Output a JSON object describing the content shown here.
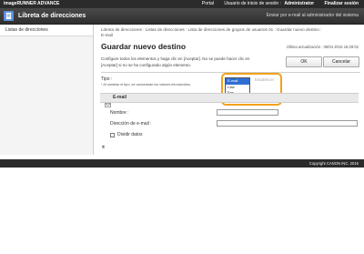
{
  "topbar": {
    "product": "imageRUNNER ADVANCE",
    "portal": "Portal",
    "user_label": "Usuario de inicio de sesión :",
    "user_name": "Administrator",
    "logout": "Finalizar sesión"
  },
  "header": {
    "title": "Libreta de direcciones",
    "send_link": "Enviar por e-mail al administrador del sistema"
  },
  "sidebar": {
    "items": [
      {
        "label": "Listas de direcciones"
      }
    ]
  },
  "main": {
    "breadcrumb_line1": "Libreta de direcciones : Listas de direcciones : Lista de direcciones de grupos de usuarios 01 : Guardar nuevo destino :",
    "breadcrumb_line2": "E-mail",
    "title": "Guardar nuevo destino",
    "last_update": "Última actualización : 09/04 2015 16:29:02",
    "ok_label": "OK",
    "cancel_label": "Cancelar",
    "instructions_line1": "Configure todos los elementos y haga clic en [Aceptar]. No se puede hacer clic en",
    "instructions_line2": "[Aceptar] si no se ha configurado algún elemento."
  },
  "type_selector": {
    "label": "Tipo :",
    "note": "* Al cambiar el tipo, se cancelarán los valores introducidos.",
    "options": [
      "E-mail",
      "I-fax",
      "Fax",
      "Archivo"
    ],
    "selected": "E-mail",
    "set_label": "Establecer"
  },
  "email_section": {
    "title": "E-mail",
    "name_label": "Nombre :",
    "name_value": "",
    "email_label": "Dirección de e-mail :",
    "email_value": "",
    "divide_label": "Dividir datos",
    "divide_checked": false
  },
  "footer": {
    "copyright": "Copyright CANON INC. 2015"
  },
  "colors": {
    "highlight": "#f2a21b",
    "selected_option": "#2f6fd3",
    "dark_bar": "#2b2b2b"
  }
}
